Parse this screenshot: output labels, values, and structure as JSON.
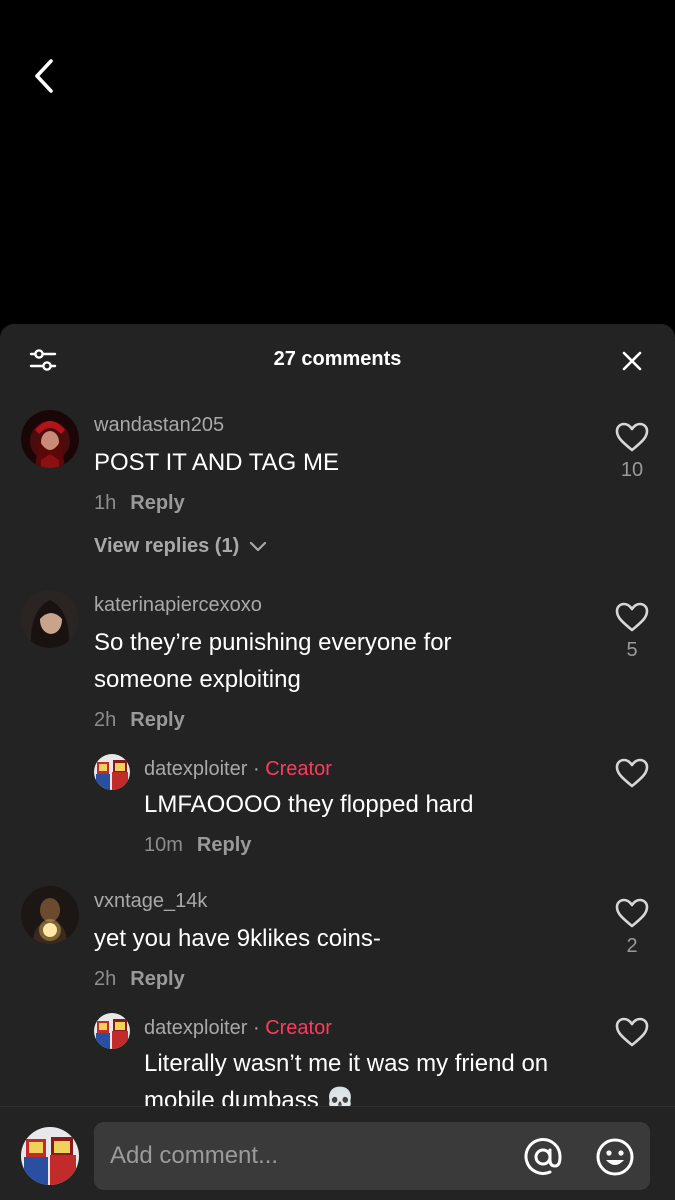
{
  "header": {
    "title": "27 comments"
  },
  "comments": [
    {
      "username": "wandastan205",
      "text": "POST IT AND TAG ME",
      "time": "1h",
      "reply_label": "Reply",
      "likes": "10",
      "view_replies": "View replies (1)",
      "avatar_icon": "avatar-wanda"
    },
    {
      "username": "katerinapiercexoxo",
      "text": "So they’re punishing everyone for someone exploiting",
      "time": "2h",
      "reply_label": "Reply",
      "likes": "5",
      "avatar_icon": "avatar-katerina"
    },
    {
      "username": "datexploiter",
      "separator": " · ",
      "creator_label": "Creator",
      "text": "LMFAOOOO they flopped hard",
      "time": "10m",
      "reply_label": "Reply",
      "likes": "",
      "avatar_icon": "avatar-creator"
    },
    {
      "username": "vxntage_14k",
      "text": "yet you have 9klikes coins-",
      "time": "2h",
      "reply_label": "Reply",
      "likes": "2",
      "avatar_icon": "avatar-vxntage"
    },
    {
      "username": "datexploiter",
      "separator": " · ",
      "creator_label": "Creator",
      "text": "Literally wasn’t me it was my friend on mobile dumbass 💀",
      "likes": "",
      "avatar_icon": "avatar-creator"
    }
  ],
  "composer": {
    "placeholder": "Add comment..."
  },
  "icons": {
    "back": "chevron-left-icon",
    "filter": "filter-sliders-icon",
    "close": "close-icon",
    "like": "heart-icon",
    "mention": "at-sign-icon",
    "emoji": "emoji-smile-icon"
  },
  "colors": {
    "background": "#000000",
    "sheet": "#232323",
    "creator": "#ff3b5c",
    "input": "#3a3a3a"
  }
}
